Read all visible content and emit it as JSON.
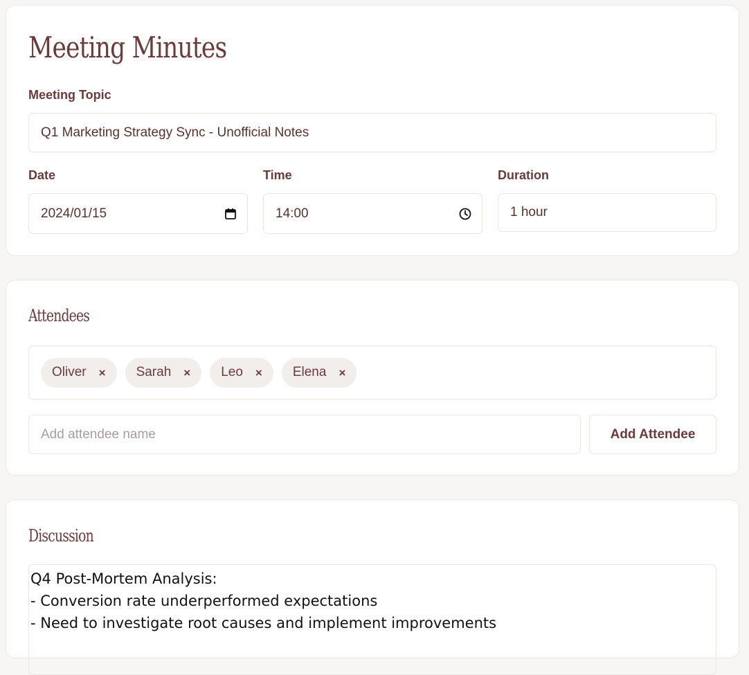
{
  "header": {
    "title": "Meeting Minutes"
  },
  "details": {
    "topic_label": "Meeting Topic",
    "topic_value": "Q1 Marketing Strategy Sync - Unofficial Notes",
    "date_label": "Date",
    "date_value": "2024/01/15",
    "time_label": "Time",
    "time_value": "14:00",
    "duration_label": "Duration",
    "duration_value": "1 hour"
  },
  "attendees": {
    "title": "Attendees",
    "list": [
      "Oliver",
      "Sarah",
      "Leo",
      "Elena"
    ],
    "remove_symbol": "×",
    "input_placeholder": "Add attendee name",
    "add_button_label": "Add Attendee"
  },
  "discussion": {
    "title": "Discussion",
    "text": "Q4 Post-Mortem Analysis:\n- Conversion rate underperformed expectations\n- Need to investigate root causes and implement improvements"
  },
  "icons": {
    "date": "calendar-icon",
    "time": "clock-icon"
  },
  "colors": {
    "accent": "#6b3a3a",
    "background": "#f8f6f4",
    "tag_bg": "#f1eeec"
  }
}
